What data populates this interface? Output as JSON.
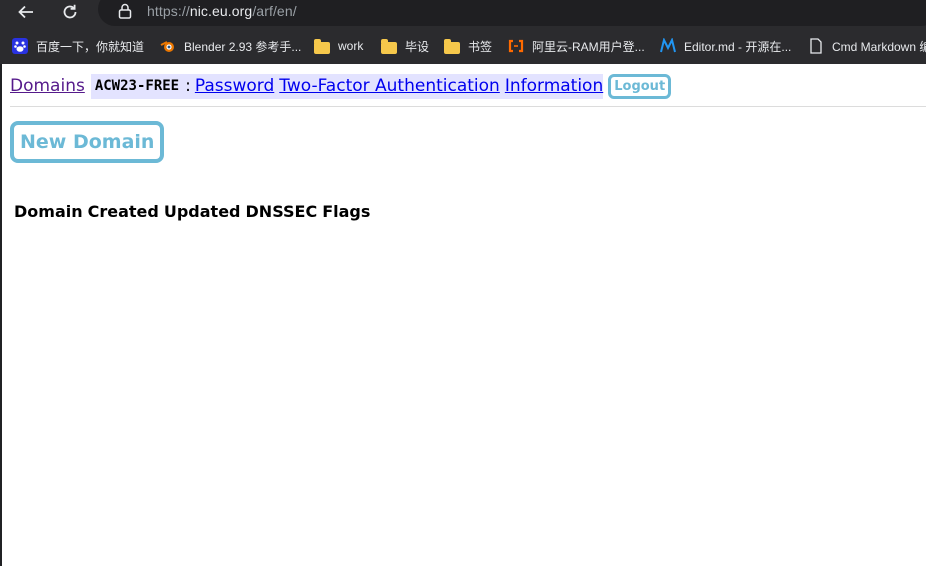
{
  "browser": {
    "url_scheme": "https://",
    "url_host": "nic.eu.org",
    "url_path": "/arf/en/",
    "bookmarks": [
      {
        "label": "百度一下，你就知道",
        "icon": "baidu-icon"
      },
      {
        "label": "Blender 2.93 参考手...",
        "icon": "blender-icon"
      },
      {
        "label": "work",
        "icon": "folder-icon"
      },
      {
        "label": "毕设",
        "icon": "folder-icon"
      },
      {
        "label": "书签",
        "icon": "folder-icon"
      },
      {
        "label": "阿里云-RAM用户登...",
        "icon": "aliyun-icon"
      },
      {
        "label": "Editor.md - 开源在...",
        "icon": "editormd-icon"
      },
      {
        "label": "Cmd Markdown 编",
        "icon": "page-icon"
      }
    ]
  },
  "nav": {
    "domains": "Domains",
    "handle": "ACW23-FREE",
    "separator": ":",
    "password": "Password",
    "two_factor": "Two-Factor Authentication",
    "information": "Information",
    "logout": "Logout"
  },
  "actions": {
    "new_domain": "New Domain"
  },
  "table": {
    "columns": [
      "Domain",
      "Created",
      "Updated",
      "DNSSEC",
      "Flags"
    ]
  },
  "colors": {
    "accent": "#6cb9d6",
    "link": "#0000ee",
    "visited": "#551a8b",
    "highlight": "#e3e3ff"
  }
}
